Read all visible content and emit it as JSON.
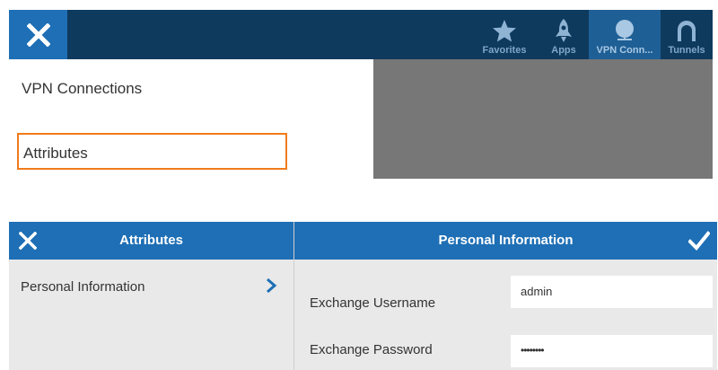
{
  "topbar": {
    "nav_items": [
      {
        "label": "Favorites",
        "icon": "star-icon"
      },
      {
        "label": "Apps",
        "icon": "rocket-icon"
      },
      {
        "label": "VPN Conn...",
        "icon": "globe-icon"
      },
      {
        "label": "Tunnels",
        "icon": "tunnel-icon"
      }
    ],
    "colors": {
      "bar": "#0e3a5e",
      "accent": "#1e6fb5",
      "highlight_border": "#f07b1c"
    }
  },
  "menu": {
    "items": [
      {
        "label": "VPN Connections"
      },
      {
        "label": "Attributes"
      }
    ]
  },
  "attributes": {
    "title": "Attributes",
    "list": [
      {
        "label": "Personal Information"
      }
    ]
  },
  "personal_info": {
    "title": "Personal Information",
    "fields": [
      {
        "label": "Exchange Username",
        "value": "admin"
      },
      {
        "label": "Exchange Password",
        "value": "••••••••"
      }
    ]
  }
}
